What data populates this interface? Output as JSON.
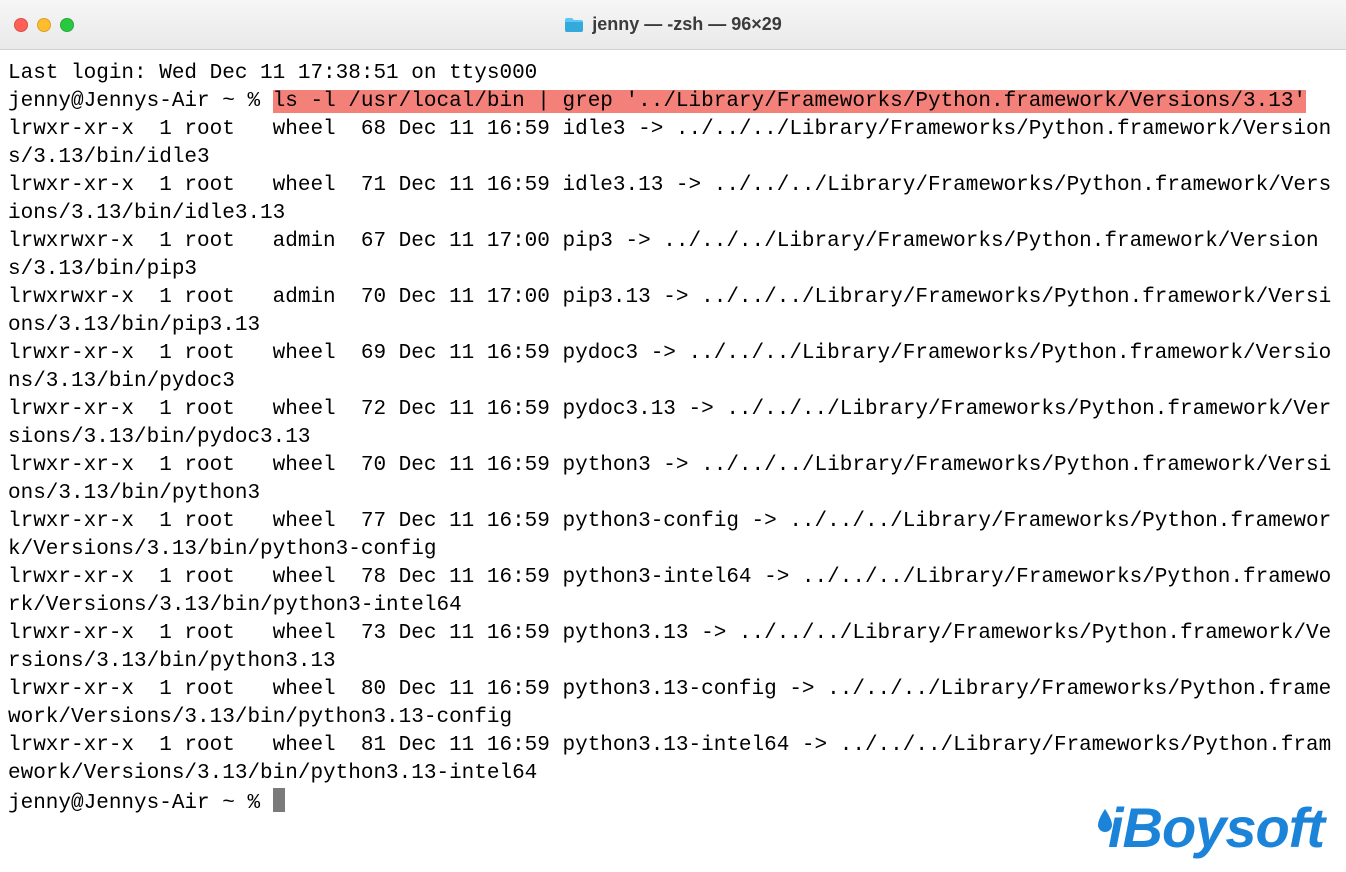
{
  "window": {
    "title": "jenny — -zsh — 96×29"
  },
  "session": {
    "last_login": "Last login: Wed Dec 11 17:38:51 on ttys000",
    "prompt": "jenny@Jennys-Air ~ % ",
    "command": "ls -l /usr/local/bin | grep '../Library/Frameworks/Python.framework/Versions/3.13'",
    "listing": [
      {
        "perm": "lrwxr-xr-x",
        "links": "1",
        "owner": "root",
        "group": "wheel",
        "size": "68",
        "date": "Dec 11 16:59",
        "name": "idle3",
        "target": "../../../Library/Frameworks/Python.framework/Versions/3.13/bin/idle3"
      },
      {
        "perm": "lrwxr-xr-x",
        "links": "1",
        "owner": "root",
        "group": "wheel",
        "size": "71",
        "date": "Dec 11 16:59",
        "name": "idle3.13",
        "target": "../../../Library/Frameworks/Python.framework/Versions/3.13/bin/idle3.13"
      },
      {
        "perm": "lrwxrwxr-x",
        "links": "1",
        "owner": "root",
        "group": "admin",
        "size": "67",
        "date": "Dec 11 17:00",
        "name": "pip3",
        "target": "../../../Library/Frameworks/Python.framework/Versions/3.13/bin/pip3"
      },
      {
        "perm": "lrwxrwxr-x",
        "links": "1",
        "owner": "root",
        "group": "admin",
        "size": "70",
        "date": "Dec 11 17:00",
        "name": "pip3.13",
        "target": "../../../Library/Frameworks/Python.framework/Versions/3.13/bin/pip3.13"
      },
      {
        "perm": "lrwxr-xr-x",
        "links": "1",
        "owner": "root",
        "group": "wheel",
        "size": "69",
        "date": "Dec 11 16:59",
        "name": "pydoc3",
        "target": "../../../Library/Frameworks/Python.framework/Versions/3.13/bin/pydoc3"
      },
      {
        "perm": "lrwxr-xr-x",
        "links": "1",
        "owner": "root",
        "group": "wheel",
        "size": "72",
        "date": "Dec 11 16:59",
        "name": "pydoc3.13",
        "target": "../../../Library/Frameworks/Python.framework/Versions/3.13/bin/pydoc3.13"
      },
      {
        "perm": "lrwxr-xr-x",
        "links": "1",
        "owner": "root",
        "group": "wheel",
        "size": "70",
        "date": "Dec 11 16:59",
        "name": "python3",
        "target": "../../../Library/Frameworks/Python.framework/Versions/3.13/bin/python3"
      },
      {
        "perm": "lrwxr-xr-x",
        "links": "1",
        "owner": "root",
        "group": "wheel",
        "size": "77",
        "date": "Dec 11 16:59",
        "name": "python3-config",
        "target": "../../../Library/Frameworks/Python.framework/Versions/3.13/bin/python3-config"
      },
      {
        "perm": "lrwxr-xr-x",
        "links": "1",
        "owner": "root",
        "group": "wheel",
        "size": "78",
        "date": "Dec 11 16:59",
        "name": "python3-intel64",
        "target": "../../../Library/Frameworks/Python.framework/Versions/3.13/bin/python3-intel64"
      },
      {
        "perm": "lrwxr-xr-x",
        "links": "1",
        "owner": "root",
        "group": "wheel",
        "size": "73",
        "date": "Dec 11 16:59",
        "name": "python3.13",
        "target": "../../../Library/Frameworks/Python.framework/Versions/3.13/bin/python3.13"
      },
      {
        "perm": "lrwxr-xr-x",
        "links": "1",
        "owner": "root",
        "group": "wheel",
        "size": "80",
        "date": "Dec 11 16:59",
        "name": "python3.13-config",
        "target": "../../../Library/Frameworks/Python.framework/Versions/3.13/bin/python3.13-config"
      },
      {
        "perm": "lrwxr-xr-x",
        "links": "1",
        "owner": "root",
        "group": "wheel",
        "size": "81",
        "date": "Dec 11 16:59",
        "name": "python3.13-intel64",
        "target": "../../../Library/Frameworks/Python.framework/Versions/3.13/bin/python3.13-intel64"
      }
    ]
  },
  "watermark": {
    "text": "iBoysoft"
  },
  "colors": {
    "highlight": "#f38079",
    "brand": "#1b83d8",
    "cursor": "#7a7a7a"
  }
}
